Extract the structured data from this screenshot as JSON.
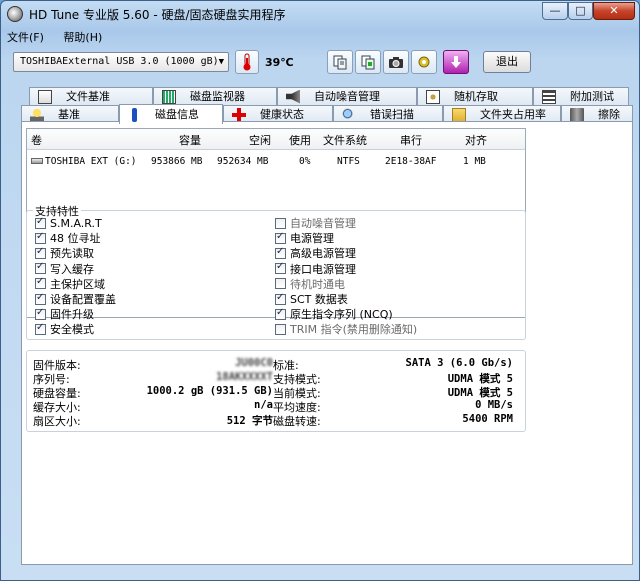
{
  "window": {
    "title": "HD Tune 专业版 5.60 - 硬盘/固态硬盘实用程序",
    "minimize": "—",
    "maximize": "□",
    "close": "✕"
  },
  "menu": {
    "file": "文件(F)",
    "help": "帮助(H)"
  },
  "toolbar": {
    "drive": "TOSHIBAExternal USB 3.0 (1000 gB)",
    "temperature": "39℃",
    "exit_label": "退出"
  },
  "tabs_row1": [
    {
      "label": "文件基准",
      "icon": "file-benchmark-icon"
    },
    {
      "label": "磁盘监视器",
      "icon": "disk-monitor-icon"
    },
    {
      "label": "自动噪音管理",
      "icon": "speaker-icon"
    },
    {
      "label": "随机存取",
      "icon": "random-access-icon"
    },
    {
      "label": "附加测试",
      "icon": "extra-tests-icon"
    }
  ],
  "tabs_row2": [
    {
      "label": "基准",
      "icon": "benchmark-icon"
    },
    {
      "label": "磁盘信息",
      "icon": "info-icon"
    },
    {
      "label": "健康状态",
      "icon": "health-icon"
    },
    {
      "label": "错误扫描",
      "icon": "error-scan-icon"
    },
    {
      "label": "文件夹占用率",
      "icon": "folder-icon"
    },
    {
      "label": "擦除",
      "icon": "erase-icon"
    }
  ],
  "volume_table": {
    "headers": [
      "卷",
      "容量",
      "空闲",
      "使用",
      "文件系统",
      "串行",
      "对齐"
    ],
    "rows": [
      [
        "TOSHIBA EXT (G:)",
        "953866 MB",
        "952634 MB",
        "0%",
        "NTFS",
        "2E18-38AF",
        "1 MB"
      ]
    ]
  },
  "features": {
    "title": "支持特性",
    "left": [
      {
        "label": "S.M.A.R.T",
        "checked": true
      },
      {
        "label": "48 位寻址",
        "checked": true
      },
      {
        "label": "预先读取",
        "checked": true
      },
      {
        "label": "写入缓存",
        "checked": true
      },
      {
        "label": "主保护区域",
        "checked": true
      },
      {
        "label": "设备配置覆盖",
        "checked": true
      },
      {
        "label": "固件升级",
        "checked": true
      },
      {
        "label": "安全模式",
        "checked": true
      }
    ],
    "right": [
      {
        "label": "自动噪音管理",
        "checked": false
      },
      {
        "label": "电源管理",
        "checked": true
      },
      {
        "label": "高级电源管理",
        "checked": true
      },
      {
        "label": "接口电源管理",
        "checked": true
      },
      {
        "label": "待机时通电",
        "checked": false
      },
      {
        "label": "SCT 数据表",
        "checked": true
      },
      {
        "label": "原生指令序列 (NCQ)",
        "checked": true
      },
      {
        "label": "TRIM 指令(禁用删除通知)",
        "checked": false
      }
    ]
  },
  "info_left": [
    {
      "label": "固件版本:",
      "value": "JU00C0"
    },
    {
      "label": "序列号:",
      "value": "18AKXXXXT"
    },
    {
      "label": "硬盘容量:",
      "value": "1000.2 gB (931.5 GB)"
    },
    {
      "label": "缓存大小:",
      "value": "n/a"
    },
    {
      "label": "扇区大小:",
      "value": "512 字节"
    }
  ],
  "info_right": [
    {
      "label": "标准:",
      "value": "SATA 3 (6.0 Gb/s)"
    },
    {
      "label": "支持模式:",
      "value": "UDMA 模式 5"
    },
    {
      "label": "当前模式:",
      "value": "UDMA 模式 5"
    },
    {
      "label": "平均速度:",
      "value": "0 MB/s"
    },
    {
      "label": "磁盘转速:",
      "value": "5400 RPM"
    }
  ]
}
